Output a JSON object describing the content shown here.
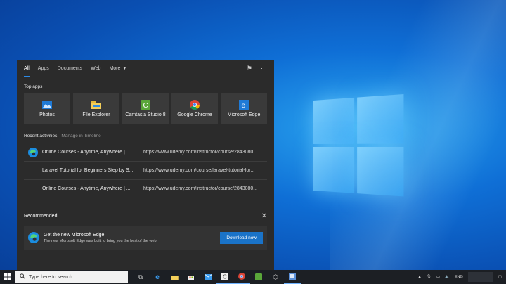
{
  "search_panel": {
    "tabs": [
      {
        "label": "All",
        "active": true
      },
      {
        "label": "Apps"
      },
      {
        "label": "Documents"
      },
      {
        "label": "Web"
      },
      {
        "label": "More"
      }
    ],
    "top_apps_title": "Top apps",
    "top_apps": [
      {
        "label": "Photos",
        "icon": "photos-icon"
      },
      {
        "label": "File Explorer",
        "icon": "folder-icon"
      },
      {
        "label": "Camtasia Studio 8",
        "icon": "camtasia-icon"
      },
      {
        "label": "Google Chrome",
        "icon": "chrome-icon"
      },
      {
        "label": "Microsoft Edge",
        "icon": "edge-icon"
      }
    ],
    "recent_title": "Recent activities",
    "recent_link": "Manage in Timeline",
    "recent": [
      {
        "title": "Online Courses - Anytime, Anywhere | ...",
        "url": "https://www.udemy.com/instructor/course/2843080..."
      },
      {
        "title": "Laravel Tutorial for Beginners Step by S...",
        "url": "https://www.udemy.com/course/laravel-tutorial-for..."
      },
      {
        "title": "Online Courses - Anytime, Anywhere | ...",
        "url": "https://www.udemy.com/instructor/course/2843080..."
      }
    ],
    "recommended_title": "Recommended",
    "recommended": {
      "title": "Get the new Microsoft Edge",
      "subtitle": "The new Microsoft Edge was built to bring you the best of the web.",
      "button": "Download now"
    }
  },
  "taskbar": {
    "search_placeholder": "Type here to search",
    "lang": "ENG"
  },
  "colors": {
    "accent": "#1a73c8",
    "panel_bg": "#2b2b2b"
  }
}
